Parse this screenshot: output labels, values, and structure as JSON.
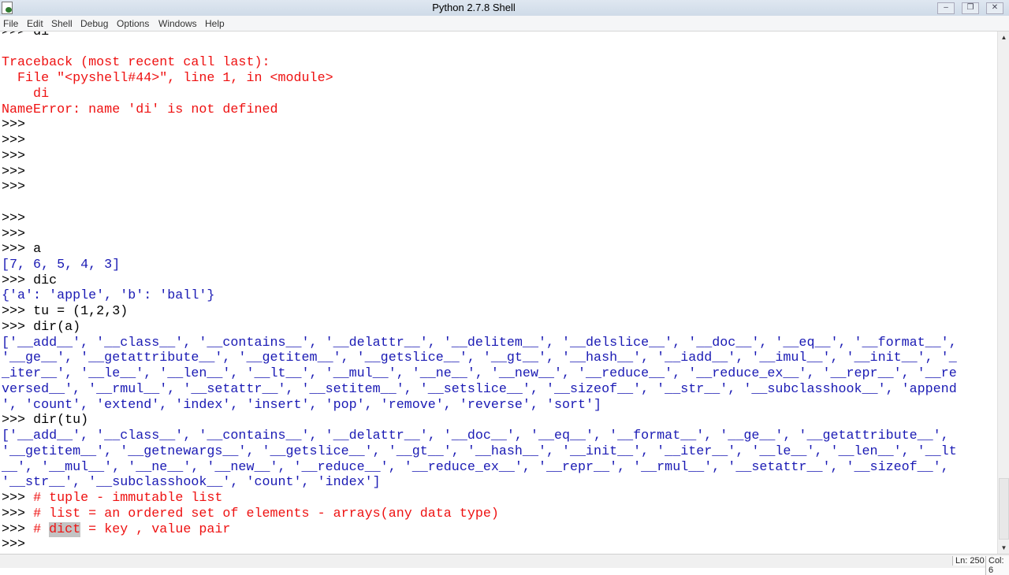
{
  "window": {
    "title": "Python 2.7.8 Shell"
  },
  "menu": [
    "File",
    "Edit",
    "Shell",
    "Debug",
    "Options",
    "Windows",
    "Help"
  ],
  "colors": {
    "output": "#1a1ab4",
    "error": "#e11111",
    "code": "#000000"
  },
  "status": {
    "line": "Ln: 250",
    "col": "Col: 6"
  },
  "lines": [
    [
      {
        "t": ">>> ",
        "c": "prompt"
      },
      {
        "t": "di",
        "c": "code"
      }
    ],
    [],
    [
      {
        "t": "Traceback (most recent call last):",
        "c": "err"
      }
    ],
    [
      {
        "t": "  File \"<pyshell#44>\", line 1, in <module>",
        "c": "err"
      }
    ],
    [
      {
        "t": "    di",
        "c": "err"
      }
    ],
    [
      {
        "t": "NameError: name 'di' is not defined",
        "c": "err"
      }
    ],
    [
      {
        "t": ">>> ",
        "c": "prompt"
      }
    ],
    [
      {
        "t": ">>> ",
        "c": "prompt"
      }
    ],
    [
      {
        "t": ">>> ",
        "c": "prompt"
      }
    ],
    [
      {
        "t": ">>> ",
        "c": "prompt"
      }
    ],
    [
      {
        "t": ">>> ",
        "c": "prompt"
      }
    ],
    [],
    [
      {
        "t": ">>> ",
        "c": "prompt"
      }
    ],
    [
      {
        "t": ">>> ",
        "c": "prompt"
      }
    ],
    [
      {
        "t": ">>> ",
        "c": "prompt"
      },
      {
        "t": "a",
        "c": "code"
      }
    ],
    [
      {
        "t": "[7, 6, 5, 4, 3]",
        "c": "out"
      }
    ],
    [
      {
        "t": ">>> ",
        "c": "prompt"
      },
      {
        "t": "dic",
        "c": "code"
      }
    ],
    [
      {
        "t": "{'a': 'apple', 'b': 'ball'}",
        "c": "out"
      }
    ],
    [
      {
        "t": ">>> ",
        "c": "prompt"
      },
      {
        "t": "tu = (1,2,3)",
        "c": "code"
      }
    ],
    [
      {
        "t": ">>> ",
        "c": "prompt"
      },
      {
        "t": "dir(a)",
        "c": "code"
      }
    ],
    [
      {
        "t": "['__add__', '__class__', '__contains__', '__delattr__', '__delitem__', '__delslice__', '__doc__', '__eq__', '__format__',",
        "c": "out"
      }
    ],
    [
      {
        "t": "'__ge__', '__getattribute__', '__getitem__', '__getslice__', '__gt__', '__hash__', '__iadd__', '__imul__', '__init__', '_",
        "c": "out"
      }
    ],
    [
      {
        "t": "_iter__', '__le__', '__len__', '__lt__', '__mul__', '__ne__', '__new__', '__reduce__', '__reduce_ex__', '__repr__', '__re",
        "c": "out"
      }
    ],
    [
      {
        "t": "versed__', '__rmul__', '__setattr__', '__setitem__', '__setslice__', '__sizeof__', '__str__', '__subclasshook__', 'append",
        "c": "out"
      }
    ],
    [
      {
        "t": "', 'count', 'extend', 'index', 'insert', 'pop', 'remove', 'reverse', 'sort']",
        "c": "out"
      }
    ],
    [
      {
        "t": ">>> ",
        "c": "prompt"
      },
      {
        "t": "dir(tu)",
        "c": "code"
      }
    ],
    [
      {
        "t": "['__add__', '__class__', '__contains__', '__delattr__', '__doc__', '__eq__', '__format__', '__ge__', '__getattribute__',",
        "c": "out"
      }
    ],
    [
      {
        "t": "'__getitem__', '__getnewargs__', '__getslice__', '__gt__', '__hash__', '__init__', '__iter__', '__le__', '__len__', '__lt",
        "c": "out"
      }
    ],
    [
      {
        "t": "__', '__mul__', '__ne__', '__new__', '__reduce__', '__reduce_ex__', '__repr__', '__rmul__', '__setattr__', '__sizeof__',",
        "c": "out"
      }
    ],
    [
      {
        "t": "'__str__', '__subclasshook__', 'count', 'index']",
        "c": "out"
      }
    ],
    [
      {
        "t": ">>> ",
        "c": "prompt"
      },
      {
        "t": "# tuple - immutable list",
        "c": "err"
      }
    ],
    [
      {
        "t": ">>> ",
        "c": "prompt"
      },
      {
        "t": "# list = an ordered set of elements - arrays(any data type)",
        "c": "err"
      }
    ],
    [
      {
        "t": ">>> ",
        "c": "prompt"
      },
      {
        "t": "# ",
        "c": "err"
      },
      {
        "t": "dict",
        "c": "err sel"
      },
      {
        "t": " = key , value pair",
        "c": "err"
      }
    ],
    [
      {
        "t": ">>> ",
        "c": "prompt"
      }
    ]
  ]
}
